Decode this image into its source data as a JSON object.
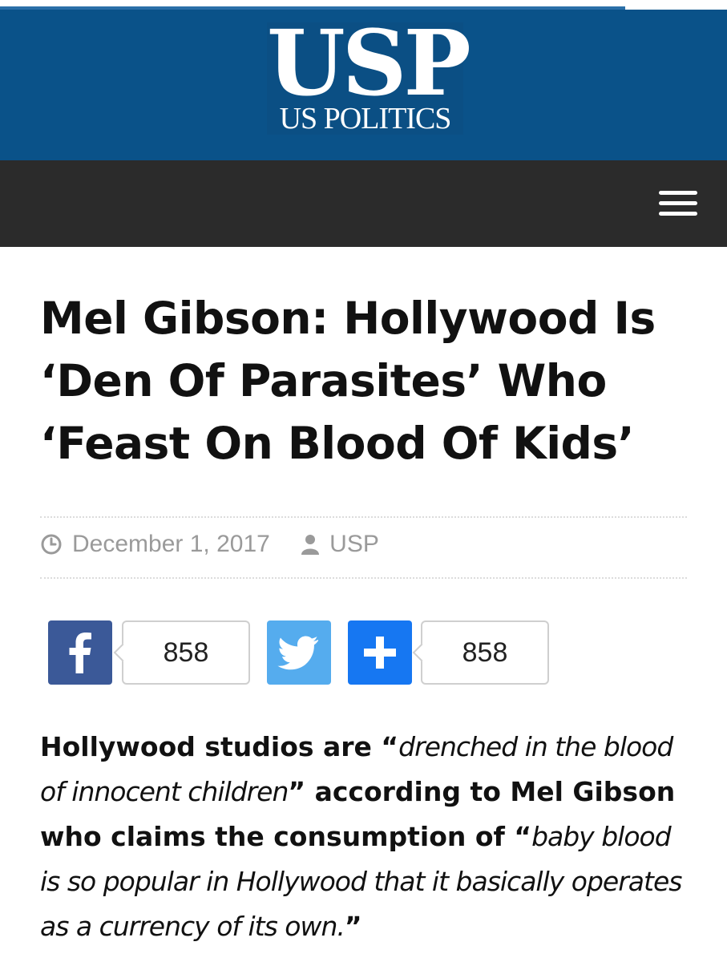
{
  "site": {
    "logo_big": "USP",
    "logo_small": "US POLITICS"
  },
  "navbar": {
    "menu_icon": "hamburger-menu-icon"
  },
  "article": {
    "title": "Mel Gibson: Hollywood Is ‘Den Of Parasites’ Who ‘Feast On Blood Of Kids’",
    "date": "December 1, 2017",
    "author": "USP",
    "date_icon": "clock-icon",
    "author_icon": "user-icon"
  },
  "share": {
    "facebook_count": "858",
    "addthis_count": "858",
    "facebook_icon": "facebook-icon",
    "twitter_icon": "twitter-icon",
    "addthis_icon": "plus-icon"
  },
  "body": {
    "p1_a": "Hollywood studios are “",
    "p1_b": "drenched in the blood of innocent children",
    "p1_c": "” according to Mel Gibson who claims the consumption of “",
    "p1_d": "baby blood is so popular in Hollywood that it basically operates as a currency of its own.",
    "p1_e": "”"
  },
  "colors": {
    "header_bg": "#0a5289",
    "navbar_bg": "#2b2b2b",
    "facebook": "#3b5998",
    "twitter": "#55acee",
    "addthis": "#1677f2"
  }
}
